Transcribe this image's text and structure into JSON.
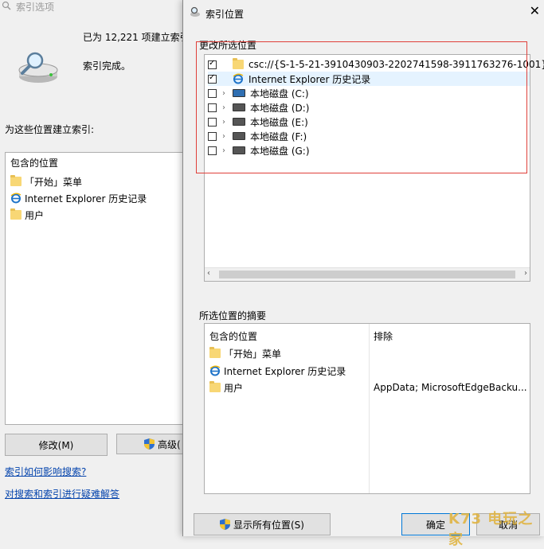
{
  "back_window": {
    "title": "索引选项",
    "summary": "已为 12,221 项建立索引",
    "status": "索引完成。",
    "heading": "为这些位置建立索引:",
    "list_header": "包含的位置",
    "items": [
      "「开始」菜单",
      "Internet Explorer 历史记录",
      "用户"
    ],
    "modify_button": "修改(M)",
    "advanced_button": "高级(",
    "link_affect": "索引如何影响搜索?",
    "link_troubleshoot": "对搜索和索引进行疑难解答"
  },
  "dialog": {
    "title": "索引位置",
    "change_label": "更改所选位置",
    "tree": [
      {
        "label": "csc://{S-1-5-21-3910430903-2202741598-3911763276-1001}/",
        "checked": true,
        "icon": "folder-icon",
        "expandable": false
      },
      {
        "label": "Internet Explorer 历史记录",
        "checked": true,
        "icon": "ie-icon",
        "expandable": false
      },
      {
        "label": "本地磁盘 (C:)",
        "checked": false,
        "icon": "system-drive-icon",
        "expandable": true
      },
      {
        "label": "本地磁盘 (D:)",
        "checked": false,
        "icon": "drive-icon",
        "expandable": true
      },
      {
        "label": "本地磁盘 (E:)",
        "checked": false,
        "icon": "drive-icon",
        "expandable": true
      },
      {
        "label": "本地磁盘 (F:)",
        "checked": false,
        "icon": "drive-icon",
        "expandable": true
      },
      {
        "label": "本地磁盘 (G:)",
        "checked": false,
        "icon": "drive-icon",
        "expandable": true
      }
    ],
    "summary_label": "所选位置的摘要",
    "summary_col_included": "包含的位置",
    "summary_col_excluded": "排除",
    "summary_items": [
      "「开始」菜单",
      "Internet Explorer 历史记录",
      "用户"
    ],
    "summary_exclusion": "AppData; MicrosoftEdgeBacku...",
    "show_all_button": "显示所有位置(S)",
    "ok_button": "确定",
    "cancel_button": "取消"
  },
  "watermark": "K73 电玩之家",
  "colors": {
    "highlight": "#e0403a",
    "selection": "#e5f3ff",
    "link": "#0645ad"
  }
}
